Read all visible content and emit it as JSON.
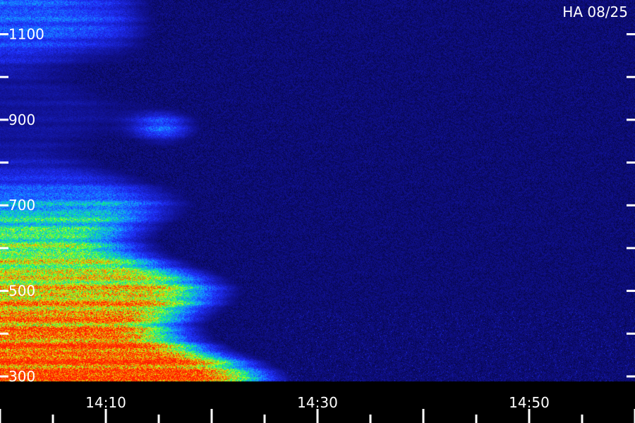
{
  "chart_data": {
    "type": "heatmap",
    "title": "HA 08/25",
    "x_ticks": [
      "14:10",
      "14:30",
      "14:50"
    ],
    "x_tick_minutes": [
      10,
      30,
      50
    ],
    "xlim_minutes": [
      0,
      60
    ],
    "y_ticks": [
      300,
      500,
      700,
      900,
      1100
    ],
    "ylim": [
      290,
      1180
    ],
    "color_scale": [
      "#000018",
      "#10108c",
      "#2030ff",
      "#10b0ff",
      "#10ff60",
      "#c8ff10",
      "#ffa000",
      "#ff2000"
    ],
    "features": [
      {
        "name": "low band intensity",
        "x": [
          0,
          12
        ],
        "y": [
          300,
          500
        ],
        "level": "high"
      },
      {
        "name": "mid band",
        "x": [
          0,
          18
        ],
        "y": [
          500,
          750
        ],
        "level": "medium"
      },
      {
        "name": "high band",
        "x": [
          0,
          12
        ],
        "y": [
          1000,
          1180
        ],
        "level": "low"
      },
      {
        "name": "isolated blob",
        "x": [
          12,
          17
        ],
        "y": [
          860,
          920
        ],
        "level": "medium"
      }
    ]
  }
}
